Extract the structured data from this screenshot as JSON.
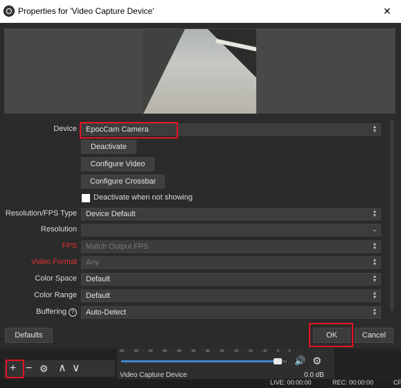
{
  "window": {
    "title": "Properties for 'Video Capture Device'",
    "close_glyph": "✕",
    "app_icon": "obs-icon"
  },
  "preview": {
    "description_icon": "camera-preview-image"
  },
  "properties": {
    "device": {
      "label": "Device",
      "value": "EpocCam Camera"
    },
    "deactivate_button": "Deactivate",
    "configure_video_button": "Configure Video",
    "configure_crossbar_button": "Configure Crossbar",
    "deactivate_when_not_showing": {
      "label": "Deactivate when not showing",
      "checked": false
    },
    "resolution_fps_type": {
      "label": "Resolution/FPS Type",
      "value": "Device Default"
    },
    "resolution": {
      "label": "Resolution",
      "value": ""
    },
    "fps": {
      "label": "FPS",
      "value": "Match Output FPS"
    },
    "video_format": {
      "label": "Video Format",
      "value": "Any"
    },
    "color_space": {
      "label": "Color Space",
      "value": "Default"
    },
    "color_range": {
      "label": "Color Range",
      "value": "Default"
    },
    "buffering": {
      "label": "Buffering",
      "value": "Auto-Detect",
      "help_glyph": "?"
    }
  },
  "footer": {
    "defaults_button": "Defaults",
    "ok_button": "OK",
    "cancel_button": "Cancel"
  },
  "sources_toolbar": {
    "add": "+",
    "remove": "−",
    "settings": "⚙",
    "up": "∧",
    "down": "∨"
  },
  "mixer": {
    "ticks": "-60 -55 -50 -45 -40 -35 -30 -25 -20 -15 -10 -5 0",
    "source_name": "Video Capture Device",
    "db": "0.0 dB",
    "volume_fraction": 0.97
  },
  "status": {
    "live": "LIVE: 00:00:00",
    "rec": "REC: 00:00:00",
    "cpu": "CP"
  },
  "colors": {
    "highlight": "#e81123",
    "accent": "#3f87d0"
  }
}
